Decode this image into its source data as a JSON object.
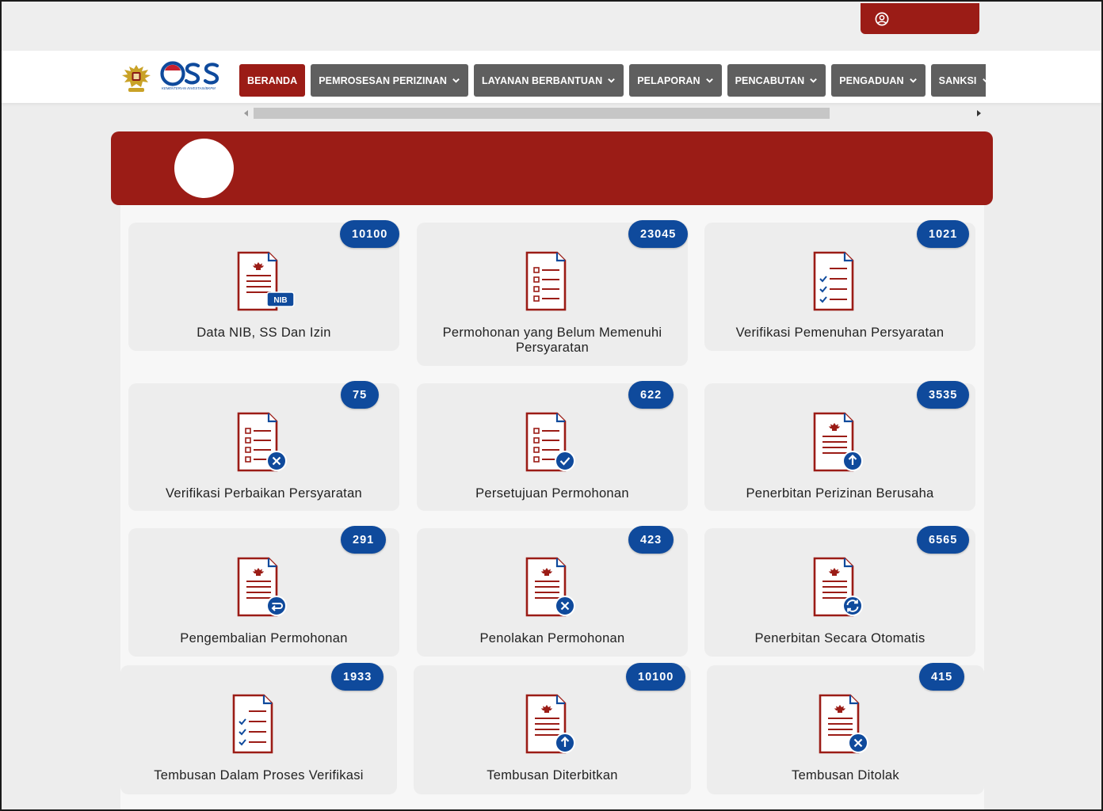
{
  "header": {
    "nav": [
      {
        "label": "BERANDA",
        "active": true,
        "dropdown": false
      },
      {
        "label": "PEMROSESAN PERIZINAN",
        "active": false,
        "dropdown": true
      },
      {
        "label": "LAYANAN BERBANTUAN",
        "active": false,
        "dropdown": true
      },
      {
        "label": "PELAPORAN",
        "active": false,
        "dropdown": true
      },
      {
        "label": "PENCABUTAN",
        "active": false,
        "dropdown": true
      },
      {
        "label": "PENGADUAN",
        "active": false,
        "dropdown": true
      },
      {
        "label": "SANKSI",
        "active": false,
        "dropdown": true
      }
    ],
    "logo_text": "OSS",
    "logo_subtext": "KEMENTERIAN INVESTASI/BKPM"
  },
  "colors": {
    "brand_red": "#9b1c16",
    "badge_blue": "#0f4a9c",
    "nav_gray": "#5f5f5f"
  },
  "cards": [
    {
      "count": "10100",
      "label": "Data NIB, SS Dan Izin",
      "icon": "document-nib-icon"
    },
    {
      "count": "23045",
      "label": "Permohonan yang Belum Memenuhi Persyaratan",
      "icon": "document-list-icon"
    },
    {
      "count": "1021",
      "label": "Verifikasi Pemenuhan Persyaratan",
      "icon": "document-checklist-icon"
    },
    {
      "count": "75",
      "label": "Verifikasi Perbaikan Persyaratan",
      "icon": "document-list-x-icon"
    },
    {
      "count": "622",
      "label": "Persetujuan Permohonan",
      "icon": "document-list-check-icon"
    },
    {
      "count": "3535",
      "label": "Penerbitan Perizinan Berusaha",
      "icon": "document-upload-icon"
    },
    {
      "count": "291",
      "label": "Pengembalian Permohonan",
      "icon": "document-return-icon"
    },
    {
      "count": "423",
      "label": "Penolakan Permohonan",
      "icon": "document-reject-icon"
    },
    {
      "count": "6565",
      "label": "Penerbitan Secara Otomatis",
      "icon": "document-sync-icon"
    },
    {
      "count": "1933",
      "label": "Tembusan Dalam Proses Verifikasi",
      "icon": "document-checklist-icon"
    },
    {
      "count": "10100",
      "label": "Tembusan Diterbitkan",
      "icon": "document-upload-icon"
    },
    {
      "count": "415",
      "label": "Tembusan Ditolak",
      "icon": "document-reject-icon"
    }
  ]
}
